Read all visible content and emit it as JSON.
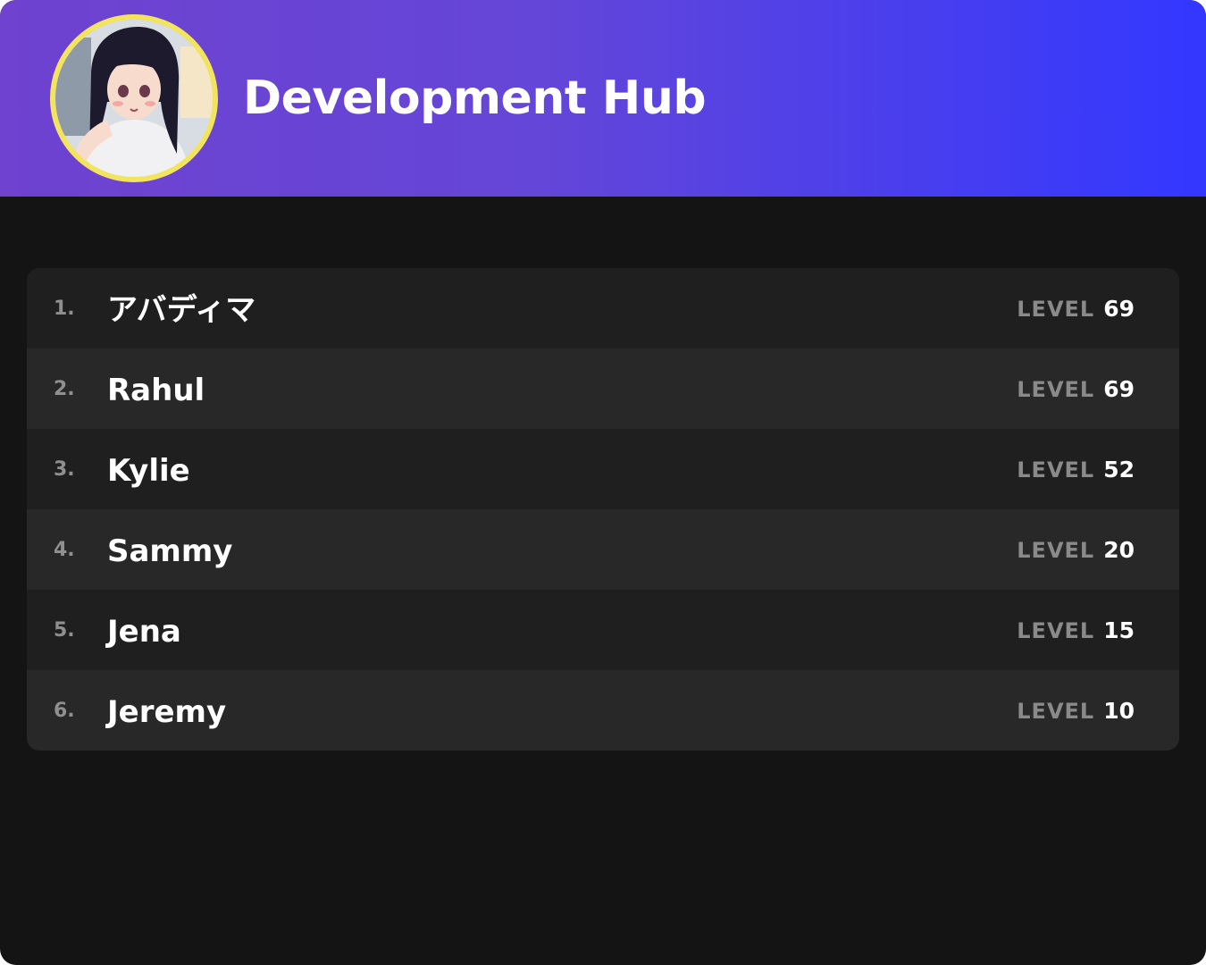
{
  "header": {
    "title": "Development Hub",
    "avatar_icon": "anime-girl-avatar",
    "gradient_start": "#6f42cf",
    "gradient_end": "#3338ff",
    "avatar_ring_color": "#f2e45c"
  },
  "leaderboard": {
    "level_label": "LEVEL",
    "rows": [
      {
        "rank": "1.",
        "name": "アバディマ",
        "level": "69"
      },
      {
        "rank": "2.",
        "name": "Rahul",
        "level": "69"
      },
      {
        "rank": "3.",
        "name": "Kylie",
        "level": "52"
      },
      {
        "rank": "4.",
        "name": "Sammy",
        "level": "20"
      },
      {
        "rank": "5.",
        "name": "Jena",
        "level": "15"
      },
      {
        "rank": "6.",
        "name": "Jeremy",
        "level": "10"
      }
    ]
  },
  "theme": {
    "background": "#141414",
    "row_odd": "#1f1f1f",
    "row_even": "#282828",
    "muted_text": "#8a8a8a",
    "text": "#ffffff"
  }
}
